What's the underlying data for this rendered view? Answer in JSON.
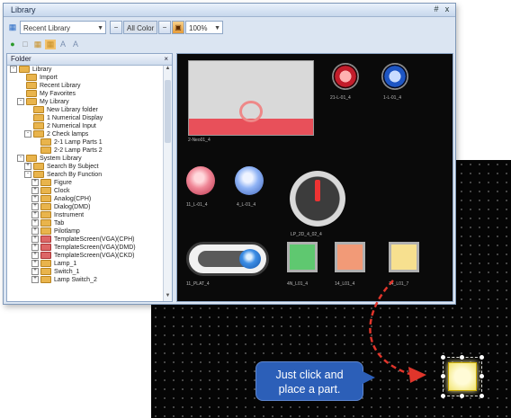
{
  "window": {
    "title": "Library",
    "controls": {
      "pin": "#",
      "close": "x"
    }
  },
  "toolbar": {
    "library_select": "Recent Library",
    "mode_select": "All Color",
    "zoom": "100%"
  },
  "tree": {
    "header": "Folder",
    "items": [
      {
        "label": "Library",
        "indent": 0,
        "exp": "-",
        "icon": "folder"
      },
      {
        "label": "Import",
        "indent": 1,
        "exp": "",
        "icon": "folder"
      },
      {
        "label": "Recent Library",
        "indent": 1,
        "exp": "",
        "icon": "folder"
      },
      {
        "label": "My Favorites",
        "indent": 1,
        "exp": "",
        "icon": "folder"
      },
      {
        "label": "My Library",
        "indent": 1,
        "exp": "-",
        "icon": "folder"
      },
      {
        "label": "New Library folder",
        "indent": 2,
        "exp": "",
        "icon": "folder"
      },
      {
        "label": "1 Numerical Display",
        "indent": 2,
        "exp": "",
        "icon": "folder"
      },
      {
        "label": "2 Numerical Input",
        "indent": 2,
        "exp": "",
        "icon": "folder"
      },
      {
        "label": "2 Check lamps",
        "indent": 2,
        "exp": "-",
        "icon": "folder"
      },
      {
        "label": "2-1 Lamp Parts 1",
        "indent": 3,
        "exp": "",
        "icon": "folder"
      },
      {
        "label": "2-2 Lamp Parts 2",
        "indent": 3,
        "exp": "",
        "icon": "folder"
      },
      {
        "label": "System Library",
        "indent": 1,
        "exp": "-",
        "icon": "folder"
      },
      {
        "label": "Search By Subject",
        "indent": 2,
        "exp": "+",
        "icon": "folder"
      },
      {
        "label": "Search By Function",
        "indent": 2,
        "exp": "-",
        "icon": "folder"
      },
      {
        "label": "Figure",
        "indent": 3,
        "exp": "+",
        "icon": "folder"
      },
      {
        "label": "Clock",
        "indent": 3,
        "exp": "+",
        "icon": "folder"
      },
      {
        "label": "Analog(CPH)",
        "indent": 3,
        "exp": "+",
        "icon": "folder"
      },
      {
        "label": "Dialog(DMD)",
        "indent": 3,
        "exp": "+",
        "icon": "folder"
      },
      {
        "label": "Instrument",
        "indent": 3,
        "exp": "+",
        "icon": "folder"
      },
      {
        "label": "Tab",
        "indent": 3,
        "exp": "+",
        "icon": "folder"
      },
      {
        "label": "Pilotlamp",
        "indent": 3,
        "exp": "+",
        "icon": "folder"
      },
      {
        "label": "TemplateScreen(VGA)(CPH)",
        "indent": 3,
        "exp": "+",
        "icon": "red"
      },
      {
        "label": "TemplateScreen(VGA)(DMD)",
        "indent": 3,
        "exp": "+",
        "icon": "red"
      },
      {
        "label": "TemplateScreen(VGA)(CKD)",
        "indent": 3,
        "exp": "+",
        "icon": "red"
      },
      {
        "label": "Lamp_1",
        "indent": 3,
        "exp": "+",
        "icon": "folder"
      },
      {
        "label": "Switch_1",
        "indent": 3,
        "exp": "+",
        "icon": "folder"
      },
      {
        "label": "Lamp Switch_2",
        "indent": 3,
        "exp": "+",
        "icon": "folder"
      }
    ]
  },
  "preview": {
    "labels": {
      "big_switch": "2-Neo01_4",
      "lamp_red_top": "21-L-01_4",
      "lamp_blue_top": "1-L-01_4",
      "lamp_red_bottom": "11_L-01_4",
      "lamp_blue_bottom": "4_L-01_4",
      "knob": "LP_2D_4_02_4",
      "toggle": "11_PLAT_4",
      "sq_green": "4N_L01_4",
      "sq_orange": "14_L01_4",
      "sq_yellow": "14_L01_7"
    }
  },
  "callout": {
    "line1": "Just click and",
    "line2": "place a part."
  },
  "colors": {
    "window_bg": "#dbe5f2",
    "callout_bg": "#2c5fb8",
    "arrow": "#e0352b",
    "placed_part": "#f1e36a"
  }
}
